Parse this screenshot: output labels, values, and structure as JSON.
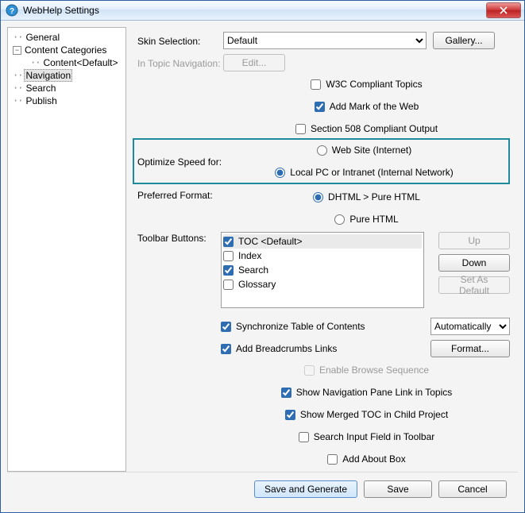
{
  "window": {
    "title": "WebHelp Settings",
    "close": "✕"
  },
  "tree": {
    "items": [
      {
        "label": "General",
        "indent": 0,
        "exp": "-",
        "sel": false
      },
      {
        "label": "Content Categories",
        "indent": 0,
        "exp": "-",
        "sel": false
      },
      {
        "label": "Content<Default>",
        "indent": 1,
        "exp": "",
        "sel": false
      },
      {
        "label": "Navigation",
        "indent": 0,
        "exp": "",
        "sel": true
      },
      {
        "label": "Search",
        "indent": 0,
        "exp": "",
        "sel": false
      },
      {
        "label": "Publish",
        "indent": 0,
        "exp": "",
        "sel": false
      }
    ]
  },
  "skin": {
    "label": "Skin Selection:",
    "value": "Default",
    "gallery": "Gallery..."
  },
  "topicNav": {
    "label": "In Topic Navigation:",
    "edit": "Edit..."
  },
  "topChecks": {
    "w3c": "W3C Compliant Topics",
    "mow": "Add Mark of the Web",
    "s508": "Section 508 Compliant Output"
  },
  "optimize": {
    "label": "Optimize Speed for:",
    "web": "Web Site (Internet)",
    "local": "Local PC or Intranet (Internal Network)"
  },
  "format": {
    "label": "Preferred Format:",
    "dhtml": "DHTML > Pure HTML",
    "pure": "Pure HTML"
  },
  "toolbar": {
    "label": "Toolbar Buttons:",
    "items": [
      {
        "label": "TOC <Default>",
        "checked": true,
        "sel": true
      },
      {
        "label": "Index",
        "checked": false,
        "sel": false
      },
      {
        "label": "Search",
        "checked": true,
        "sel": false
      },
      {
        "label": "Glossary",
        "checked": false,
        "sel": false
      }
    ],
    "up": "Up",
    "down": "Down",
    "setdef": "Set As Default"
  },
  "optsA": {
    "sync": "Synchronize Table of Contents",
    "syncCombo": "Automatically",
    "bread": "Add Breadcrumbs Links",
    "format": "Format..."
  },
  "optsB": {
    "browse": "Enable Browse Sequence",
    "navlink": "Show Navigation Pane Link in Topics",
    "merged": "Show Merged TOC in Child Project",
    "search": "Search Input Field in Toolbar",
    "about": "Add About Box"
  },
  "footer": {
    "savegen": "Save and Generate",
    "save": "Save",
    "cancel": "Cancel"
  }
}
